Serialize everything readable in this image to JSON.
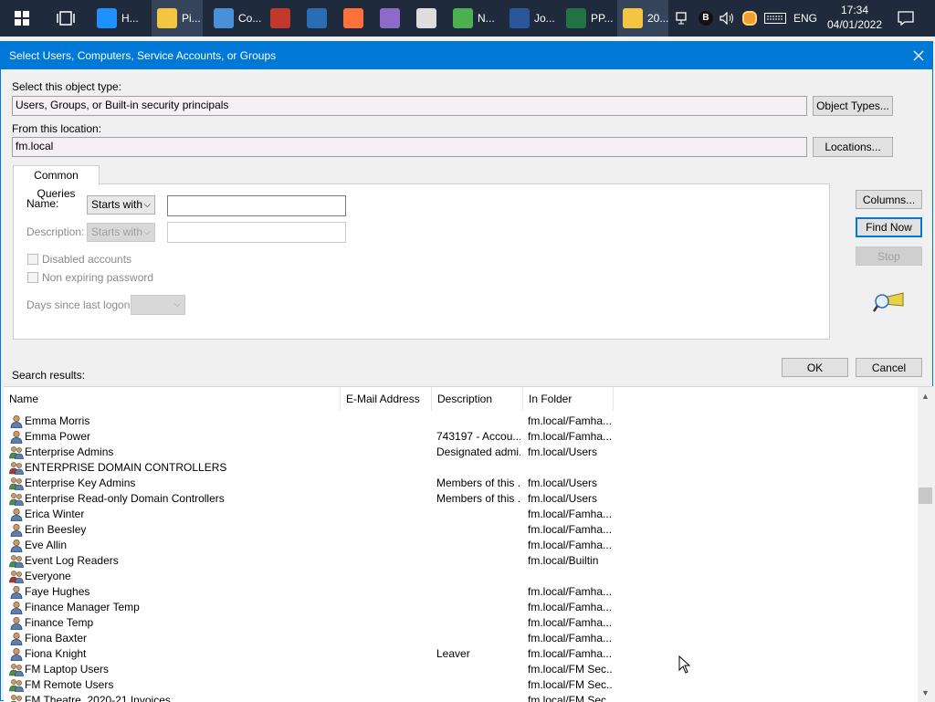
{
  "taskbar": {
    "apps": [
      {
        "label": "H...",
        "color": "#1e90ff"
      },
      {
        "label": "Pi...",
        "color": "#f4c542"
      },
      {
        "label": "Co...",
        "color": "#4a90d9"
      },
      {
        "label": "",
        "color": "#c0392b"
      },
      {
        "label": "",
        "color": "#2a6db5"
      },
      {
        "label": "",
        "color": "#ff7139"
      },
      {
        "label": "",
        "color": "#8e6bc7"
      },
      {
        "label": "",
        "color": "#dddddd"
      },
      {
        "label": "N...",
        "color": "#4caf50"
      },
      {
        "label": "Jo...",
        "color": "#2b579a"
      },
      {
        "label": "PP...",
        "color": "#217346"
      },
      {
        "label": "20...",
        "color": "#f4c542"
      }
    ],
    "language": "ENG",
    "time": "17:34",
    "date": "04/01/2022"
  },
  "dialog": {
    "title": "Select Users, Computers, Service Accounts, or Groups",
    "object_type_label": "Select this object type:",
    "object_type_value": "Users, Groups, or Built-in security principals",
    "object_types_button": "Object Types...",
    "location_label": "From this location:",
    "location_value": "fm.local",
    "locations_button": "Locations...",
    "tab_label": "Common Queries",
    "name_label": "Name:",
    "name_filter": "Starts with",
    "description_label": "Description:",
    "description_filter": "Starts with",
    "disabled_accounts_label": "Disabled accounts",
    "non_expiring_label": "Non expiring password",
    "days_since_logon_label": "Days since last logon:",
    "columns_button": "Columns...",
    "find_now_button": "Find Now",
    "stop_button": "Stop",
    "ok_button": "OK",
    "cancel_button": "Cancel",
    "search_results_label": "Search results:"
  },
  "results": {
    "columns": [
      "Name",
      "E-Mail Address",
      "Description",
      "In Folder"
    ],
    "rows": [
      {
        "name": "Emma Morris",
        "email": "",
        "description": "",
        "folder": "fm.local/Famha...",
        "icon": "user-icon"
      },
      {
        "name": "Emma Power",
        "email": "",
        "description": "743197 - Accou...",
        "folder": "fm.local/Famha...",
        "icon": "user-icon"
      },
      {
        "name": "Enterprise Admins",
        "email": "",
        "description": "Designated admi...",
        "folder": "fm.local/Users",
        "icon": "group-icon"
      },
      {
        "name": "ENTERPRISE DOMAIN CONTROLLERS",
        "email": "",
        "description": "",
        "folder": "",
        "icon": "principal-icon"
      },
      {
        "name": "Enterprise Key Admins",
        "email": "",
        "description": "Members of this ...",
        "folder": "fm.local/Users",
        "icon": "group-icon"
      },
      {
        "name": "Enterprise Read-only Domain Controllers",
        "email": "",
        "description": "Members of this ...",
        "folder": "fm.local/Users",
        "icon": "group-icon"
      },
      {
        "name": "Erica Winter",
        "email": "",
        "description": "",
        "folder": "fm.local/Famha...",
        "icon": "user-icon"
      },
      {
        "name": "Erin Beesley",
        "email": "",
        "description": "",
        "folder": "fm.local/Famha...",
        "icon": "user-icon"
      },
      {
        "name": "Eve Allin",
        "email": "",
        "description": "",
        "folder": "fm.local/Famha...",
        "icon": "user-icon"
      },
      {
        "name": "Event Log Readers",
        "email": "",
        "description": "",
        "folder": "fm.local/Builtin",
        "icon": "group-icon"
      },
      {
        "name": "Everyone",
        "email": "",
        "description": "",
        "folder": "",
        "icon": "principal-icon"
      },
      {
        "name": "Faye Hughes",
        "email": "",
        "description": "",
        "folder": "fm.local/Famha...",
        "icon": "user-icon"
      },
      {
        "name": "Finance Manager Temp",
        "email": "",
        "description": "",
        "folder": "fm.local/Famha...",
        "icon": "user-icon"
      },
      {
        "name": "Finance Temp",
        "email": "",
        "description": "",
        "folder": "fm.local/Famha...",
        "icon": "user-icon"
      },
      {
        "name": "Fiona Baxter",
        "email": "",
        "description": "",
        "folder": "fm.local/Famha...",
        "icon": "user-icon"
      },
      {
        "name": "Fiona Knight",
        "email": "",
        "description": "Leaver",
        "folder": "fm.local/Famha...",
        "icon": "user-icon"
      },
      {
        "name": "FM Laptop Users",
        "email": "",
        "description": "",
        "folder": "fm.local/FM Sec...",
        "icon": "group-icon"
      },
      {
        "name": "FM Remote Users",
        "email": "",
        "description": "",
        "folder": "fm.local/FM Sec...",
        "icon": "group-icon"
      },
      {
        "name": "FM Theatre_2020-21 Invoices",
        "email": "",
        "description": "",
        "folder": "fm.local/FM Sec...",
        "icon": "group-icon"
      }
    ]
  }
}
